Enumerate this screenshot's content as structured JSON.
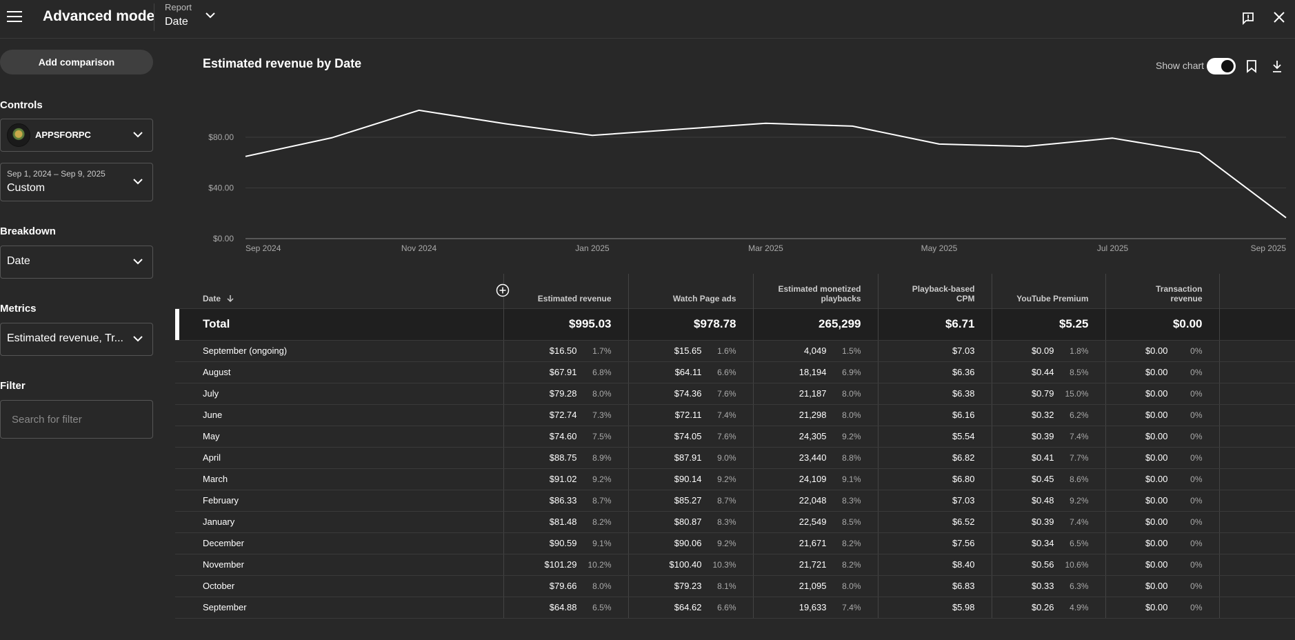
{
  "header": {
    "app_title": "Advanced mode",
    "report_caption": "Report",
    "report_value": "Date"
  },
  "sidebar": {
    "add_comparison": "Add comparison",
    "controls_label": "Controls",
    "channel_name": "APPSFORPC",
    "date_range": "Sep 1, 2024 – Sep 9, 2025",
    "date_mode": "Custom",
    "breakdown_label": "Breakdown",
    "breakdown_value": "Date",
    "metrics_label": "Metrics",
    "metrics_value": "Estimated revenue, Tr...",
    "filter_label": "Filter",
    "filter_placeholder": "Search for filter"
  },
  "chart": {
    "title": "Estimated revenue by Date",
    "show_chart_label": "Show chart"
  },
  "chart_data": {
    "type": "line",
    "title": "Estimated revenue by Date",
    "x": [
      "2024-09",
      "2024-10",
      "2024-11",
      "2024-12",
      "2025-01",
      "2025-02",
      "2025-03",
      "2025-04",
      "2025-05",
      "2025-06",
      "2025-07",
      "2025-08",
      "2025-09"
    ],
    "x_tick_labels": [
      "Sep 2024",
      "Nov 2024",
      "Jan 2025",
      "Mar 2025",
      "May 2025",
      "Jul 2025",
      "Sep 2025"
    ],
    "y_tick_labels": [
      "$0.00",
      "$40.00",
      "$80.00"
    ],
    "ylim": [
      0,
      120
    ],
    "grid": true,
    "series": [
      {
        "values": [
          64.88,
          79.66,
          101.29,
          90.59,
          81.48,
          86.33,
          91.02,
          88.75,
          74.6,
          72.74,
          79.28,
          67.91,
          16.5
        ]
      }
    ]
  },
  "table": {
    "columns": [
      {
        "label": "Date"
      },
      {
        "label": "Estimated revenue"
      },
      {
        "label": "Watch Page ads"
      },
      {
        "label": "Estimated monetized playbacks"
      },
      {
        "label": "Playback-based CPM"
      },
      {
        "label": "YouTube Premium"
      },
      {
        "label": "Transaction revenue"
      }
    ],
    "total": {
      "label": "Total",
      "values": [
        "$995.03",
        "$978.78",
        "265,299",
        "$6.71",
        "$5.25",
        "$0.00"
      ]
    },
    "rows": [
      {
        "date": "September (ongoing)",
        "rev": "$16.50",
        "rev_pct": "1.7%",
        "wpa": "$15.65",
        "wpa_pct": "1.6%",
        "plays": "4,049",
        "plays_pct": "1.5%",
        "cpm": "$7.03",
        "prem": "$0.09",
        "prem_pct": "1.8%",
        "trans": "$0.00",
        "trans_pct": "0%"
      },
      {
        "date": "August",
        "rev": "$67.91",
        "rev_pct": "6.8%",
        "wpa": "$64.11",
        "wpa_pct": "6.6%",
        "plays": "18,194",
        "plays_pct": "6.9%",
        "cpm": "$6.36",
        "prem": "$0.44",
        "prem_pct": "8.5%",
        "trans": "$0.00",
        "trans_pct": "0%"
      },
      {
        "date": "July",
        "rev": "$79.28",
        "rev_pct": "8.0%",
        "wpa": "$74.36",
        "wpa_pct": "7.6%",
        "plays": "21,187",
        "plays_pct": "8.0%",
        "cpm": "$6.38",
        "prem": "$0.79",
        "prem_pct": "15.0%",
        "trans": "$0.00",
        "trans_pct": "0%"
      },
      {
        "date": "June",
        "rev": "$72.74",
        "rev_pct": "7.3%",
        "wpa": "$72.11",
        "wpa_pct": "7.4%",
        "plays": "21,298",
        "plays_pct": "8.0%",
        "cpm": "$6.16",
        "prem": "$0.32",
        "prem_pct": "6.2%",
        "trans": "$0.00",
        "trans_pct": "0%"
      },
      {
        "date": "May",
        "rev": "$74.60",
        "rev_pct": "7.5%",
        "wpa": "$74.05",
        "wpa_pct": "7.6%",
        "plays": "24,305",
        "plays_pct": "9.2%",
        "cpm": "$5.54",
        "prem": "$0.39",
        "prem_pct": "7.4%",
        "trans": "$0.00",
        "trans_pct": "0%"
      },
      {
        "date": "April",
        "rev": "$88.75",
        "rev_pct": "8.9%",
        "wpa": "$87.91",
        "wpa_pct": "9.0%",
        "plays": "23,440",
        "plays_pct": "8.8%",
        "cpm": "$6.82",
        "prem": "$0.41",
        "prem_pct": "7.7%",
        "trans": "$0.00",
        "trans_pct": "0%"
      },
      {
        "date": "March",
        "rev": "$91.02",
        "rev_pct": "9.2%",
        "wpa": "$90.14",
        "wpa_pct": "9.2%",
        "plays": "24,109",
        "plays_pct": "9.1%",
        "cpm": "$6.80",
        "prem": "$0.45",
        "prem_pct": "8.6%",
        "trans": "$0.00",
        "trans_pct": "0%"
      },
      {
        "date": "February",
        "rev": "$86.33",
        "rev_pct": "8.7%",
        "wpa": "$85.27",
        "wpa_pct": "8.7%",
        "plays": "22,048",
        "plays_pct": "8.3%",
        "cpm": "$7.03",
        "prem": "$0.48",
        "prem_pct": "9.2%",
        "trans": "$0.00",
        "trans_pct": "0%"
      },
      {
        "date": "January",
        "rev": "$81.48",
        "rev_pct": "8.2%",
        "wpa": "$80.87",
        "wpa_pct": "8.3%",
        "plays": "22,549",
        "plays_pct": "8.5%",
        "cpm": "$6.52",
        "prem": "$0.39",
        "prem_pct": "7.4%",
        "trans": "$0.00",
        "trans_pct": "0%"
      },
      {
        "date": "December",
        "rev": "$90.59",
        "rev_pct": "9.1%",
        "wpa": "$90.06",
        "wpa_pct": "9.2%",
        "plays": "21,671",
        "plays_pct": "8.2%",
        "cpm": "$7.56",
        "prem": "$0.34",
        "prem_pct": "6.5%",
        "trans": "$0.00",
        "trans_pct": "0%"
      },
      {
        "date": "November",
        "rev": "$101.29",
        "rev_pct": "10.2%",
        "wpa": "$100.40",
        "wpa_pct": "10.3%",
        "plays": "21,721",
        "plays_pct": "8.2%",
        "cpm": "$8.40",
        "prem": "$0.56",
        "prem_pct": "10.6%",
        "trans": "$0.00",
        "trans_pct": "0%"
      },
      {
        "date": "October",
        "rev": "$79.66",
        "rev_pct": "8.0%",
        "wpa": "$79.23",
        "wpa_pct": "8.1%",
        "plays": "21,095",
        "plays_pct": "8.0%",
        "cpm": "$6.83",
        "prem": "$0.33",
        "prem_pct": "6.3%",
        "trans": "$0.00",
        "trans_pct": "0%"
      },
      {
        "date": "September",
        "rev": "$64.88",
        "rev_pct": "6.5%",
        "wpa": "$64.62",
        "wpa_pct": "6.6%",
        "plays": "19,633",
        "plays_pct": "7.4%",
        "cpm": "$5.98",
        "prem": "$0.26",
        "prem_pct": "4.9%",
        "trans": "$0.00",
        "trans_pct": "0%"
      }
    ]
  },
  "icons": {
    "menu": "menu-icon",
    "chevron": "chevron-down-icon",
    "feedback": "feedback-icon",
    "close": "close-icon",
    "bookmark": "bookmark-icon",
    "download": "download-icon",
    "sort": "arrow-down-icon",
    "add_column": "add-circle-icon"
  },
  "colors": {
    "background": "#282828",
    "total_row": "#1f1f1f",
    "line": "#ffffff"
  }
}
